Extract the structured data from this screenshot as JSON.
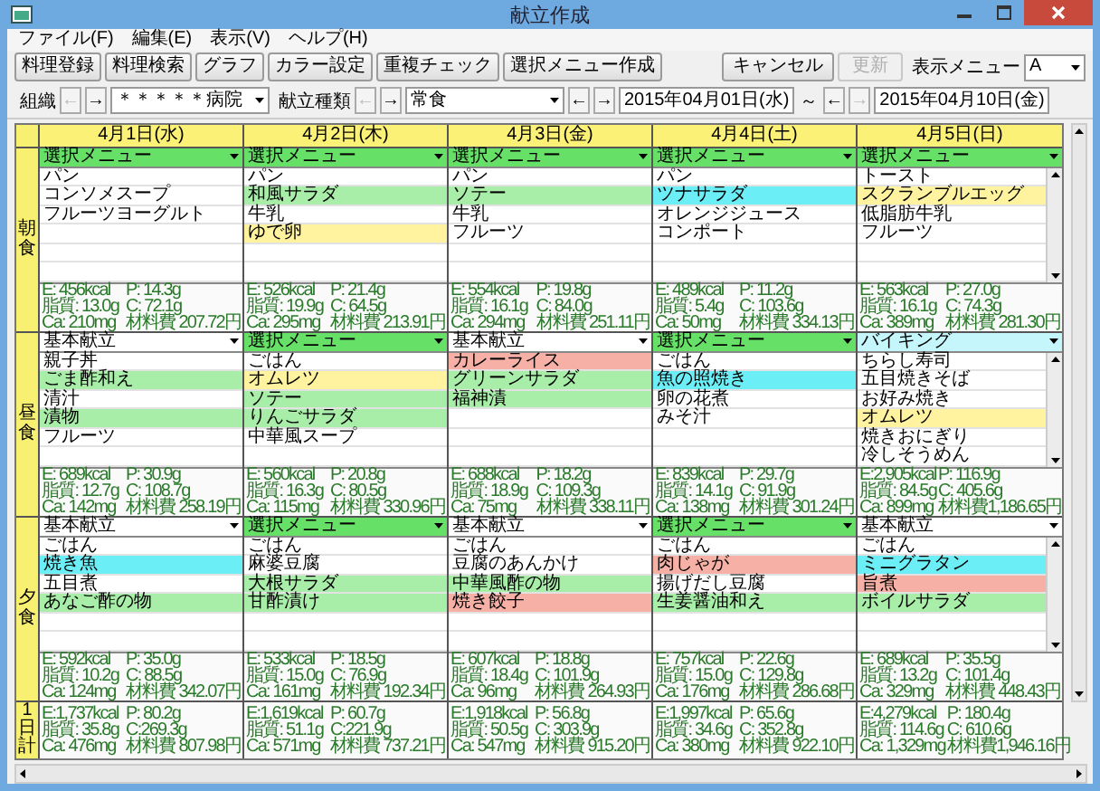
{
  "window": {
    "title": "献立作成"
  },
  "menu": [
    "ファイル(F)",
    "編集(E)",
    "表示(V)",
    "ヘルプ(H)"
  ],
  "toolbar": {
    "buttons": [
      {
        "label": "料理登録",
        "disabled": false
      },
      {
        "label": "料理検索",
        "disabled": false
      },
      {
        "label": "グラフ",
        "disabled": false
      },
      {
        "label": "カラー設定",
        "disabled": false
      },
      {
        "label": "重複チェック",
        "disabled": false
      },
      {
        "label": "選択メニュー作成",
        "disabled": false
      }
    ],
    "right_buttons": [
      {
        "label": "キャンセル",
        "disabled": false
      },
      {
        "label": "更新",
        "disabled": true
      }
    ],
    "display_menu": {
      "label": "表示メニュー",
      "value": "A"
    }
  },
  "filters": [
    {
      "kind": "dropdown",
      "label": "組織",
      "prev": "←",
      "next": "→",
      "prev_disabled": true,
      "next_disabled": false,
      "value": "＊＊＊＊＊病院"
    },
    {
      "kind": "dropdown",
      "label": "献立種類",
      "prev": "←",
      "next": "→",
      "prev_disabled": true,
      "next_disabled": false,
      "value": "常食"
    },
    {
      "kind": "date",
      "prev": "←",
      "next": "→",
      "prev_disabled": false,
      "next_disabled": false,
      "value": "2015年04月01日(水)"
    },
    {
      "kind": "separator",
      "label": "～"
    },
    {
      "kind": "date",
      "prev": "←",
      "next": "→",
      "prev_disabled": false,
      "next_disabled": true,
      "value": "2015年04月10日(金)"
    }
  ],
  "meal_labels": [
    "朝食",
    "昼食",
    "夕食"
  ],
  "total_label": "1日計",
  "days": [
    {
      "date": "4月1日(水)",
      "meals": [
        {
          "menu_type": "選択メニュー",
          "color": "#66e066",
          "scrollbar": false,
          "items": [
            {
              "name": "パン",
              "color": "#ffffff"
            },
            {
              "name": "コンソメスープ",
              "color": "#ffffff"
            },
            {
              "name": "フルーツヨーグルト",
              "color": "#ffffff"
            }
          ],
          "nutrition": [
            "E: 456kcal",
            "P: 14.3g",
            "脂質: 13.0g",
            "C: 72.1g",
            "Ca: 210mg",
            "材料費 207.72円"
          ]
        },
        {
          "menu_type": "基本献立",
          "color": "#ffffff",
          "scrollbar": false,
          "items": [
            {
              "name": "親子丼",
              "color": "#ffffff"
            },
            {
              "name": "ごま酢和え",
              "color": "#a8eea8"
            },
            {
              "name": "清汁",
              "color": "#ffffff"
            },
            {
              "name": "漬物",
              "color": "#a8eea8"
            },
            {
              "name": "フルーツ",
              "color": "#ffffff"
            }
          ],
          "nutrition": [
            "E: 689kcal",
            "P: 30.9g",
            "脂質: 12.7g",
            "C: 108.7g",
            "Ca: 142mg",
            "材料費 258.19円"
          ]
        },
        {
          "menu_type": "基本献立",
          "color": "#ffffff",
          "scrollbar": false,
          "items": [
            {
              "name": "ごはん",
              "color": "#ffffff"
            },
            {
              "name": "焼き魚",
              "color": "#6ceef6"
            },
            {
              "name": "五目煮",
              "color": "#ffffff"
            },
            {
              "name": "あなご酢の物",
              "color": "#a8eea8"
            }
          ],
          "nutrition": [
            "E: 592kcal",
            "P: 35.0g",
            "脂質: 10.2g",
            "C: 88.5g",
            "Ca: 124mg",
            "材料費 342.07円"
          ]
        }
      ],
      "total": [
        "E:1,737kcal",
        "P: 80.2g",
        "脂質: 35.8g",
        "C:269.3g",
        "Ca: 476mg",
        "材料費 807.98円"
      ]
    },
    {
      "date": "4月2日(木)",
      "meals": [
        {
          "menu_type": "選択メニュー",
          "color": "#66e066",
          "scrollbar": false,
          "items": [
            {
              "name": "パン",
              "color": "#ffffff"
            },
            {
              "name": "和風サラダ",
              "color": "#a8eea8"
            },
            {
              "name": "牛乳",
              "color": "#ffffff"
            },
            {
              "name": "ゆで卵",
              "color": "#fff3a0"
            }
          ],
          "nutrition": [
            "E: 526kcal",
            "P: 21.4g",
            "脂質: 19.9g",
            "C: 64.5g",
            "Ca: 295mg",
            "材料費 213.91円"
          ]
        },
        {
          "menu_type": "選択メニュー",
          "color": "#66e066",
          "scrollbar": false,
          "items": [
            {
              "name": "ごはん",
              "color": "#ffffff"
            },
            {
              "name": "オムレツ",
              "color": "#fff3a0"
            },
            {
              "name": "ソテー",
              "color": "#a8eea8"
            },
            {
              "name": "りんごサラダ",
              "color": "#a8eea8"
            },
            {
              "name": "中華風スープ",
              "color": "#ffffff"
            }
          ],
          "nutrition": [
            "E: 560kcal",
            "P: 20.8g",
            "脂質: 16.3g",
            "C: 80.5g",
            "Ca: 115mg",
            "材料費 330.96円"
          ]
        },
        {
          "menu_type": "選択メニュー",
          "color": "#66e066",
          "scrollbar": false,
          "items": [
            {
              "name": "ごはん",
              "color": "#ffffff"
            },
            {
              "name": "麻婆豆腐",
              "color": "#ffffff"
            },
            {
              "name": "大根サラダ",
              "color": "#a8eea8"
            },
            {
              "name": "甘酢漬け",
              "color": "#a8eea8"
            }
          ],
          "nutrition": [
            "E: 533kcal",
            "P: 18.5g",
            "脂質: 15.0g",
            "C: 76.9g",
            "Ca: 161mg",
            "材料費 192.34円"
          ]
        }
      ],
      "total": [
        "E:1,619kcal",
        "P: 60.7g",
        "脂質: 51.1g",
        "C:221.9g",
        "Ca: 571mg",
        "材料費 737.21円"
      ]
    },
    {
      "date": "4月3日(金)",
      "meals": [
        {
          "menu_type": "選択メニュー",
          "color": "#66e066",
          "scrollbar": false,
          "items": [
            {
              "name": "パン",
              "color": "#ffffff"
            },
            {
              "name": "ソテー",
              "color": "#a8eea8"
            },
            {
              "name": "牛乳",
              "color": "#ffffff"
            },
            {
              "name": "フルーツ",
              "color": "#ffffff"
            }
          ],
          "nutrition": [
            "E: 554kcal",
            "P: 19.8g",
            "脂質: 16.1g",
            "C: 84.0g",
            "Ca: 294mg",
            "材料費 251.11円"
          ]
        },
        {
          "menu_type": "基本献立",
          "color": "#ffffff",
          "scrollbar": false,
          "items": [
            {
              "name": "カレーライス",
              "color": "#f6b0a6"
            },
            {
              "name": "グリーンサラダ",
              "color": "#a8eea8"
            },
            {
              "name": "福神漬",
              "color": "#a8eea8"
            }
          ],
          "nutrition": [
            "E: 688kcal",
            "P: 18.2g",
            "脂質: 18.9g",
            "C: 109.3g",
            "Ca: 75mg",
            "材料費 338.11円"
          ]
        },
        {
          "menu_type": "基本献立",
          "color": "#ffffff",
          "scrollbar": false,
          "items": [
            {
              "name": "ごはん",
              "color": "#ffffff"
            },
            {
              "name": "豆腐のあんかけ",
              "color": "#ffffff"
            },
            {
              "name": "中華風酢の物",
              "color": "#a8eea8"
            },
            {
              "name": "焼き餃子",
              "color": "#f6b0a6"
            }
          ],
          "nutrition": [
            "E: 607kcal",
            "P: 18.8g",
            "脂質: 18.4g",
            "C: 101.9g",
            "Ca: 96mg",
            "材料費 264.93円"
          ]
        }
      ],
      "total": [
        "E:1,918kcal",
        "P: 56.8g",
        "脂質: 50.5g",
        "C: 303.9g",
        "Ca: 547mg",
        "材料費 915.20円"
      ]
    },
    {
      "date": "4月4日(土)",
      "meals": [
        {
          "menu_type": "選択メニュー",
          "color": "#66e066",
          "scrollbar": false,
          "items": [
            {
              "name": "パン",
              "color": "#ffffff"
            },
            {
              "name": "ツナサラダ",
              "color": "#6ceef6"
            },
            {
              "name": "オレンジジュース",
              "color": "#ffffff"
            },
            {
              "name": "コンポート",
              "color": "#ffffff"
            }
          ],
          "nutrition": [
            "E: 489kcal",
            "P: 11.2g",
            "脂質: 5.4g",
            "C: 103.6g",
            "Ca: 50mg",
            "材料費 334.13円"
          ]
        },
        {
          "menu_type": "選択メニュー",
          "color": "#66e066",
          "scrollbar": false,
          "items": [
            {
              "name": "ごはん",
              "color": "#ffffff"
            },
            {
              "name": "魚の照焼き",
              "color": "#6ceef6"
            },
            {
              "name": "卵の花煮",
              "color": "#ffffff"
            },
            {
              "name": "みそ汁",
              "color": "#ffffff"
            }
          ],
          "nutrition": [
            "E: 839kcal",
            "P: 29.7g",
            "脂質: 14.1g",
            "C: 91.9g",
            "Ca: 138mg",
            "材料費 301.24円"
          ]
        },
        {
          "menu_type": "選択メニュー",
          "color": "#66e066",
          "scrollbar": false,
          "items": [
            {
              "name": "ごはん",
              "color": "#ffffff"
            },
            {
              "name": "肉じゃが",
              "color": "#f6b0a6"
            },
            {
              "name": "揚げだし豆腐",
              "color": "#ffffff"
            },
            {
              "name": "生姜醤油和え",
              "color": "#a8eea8"
            }
          ],
          "nutrition": [
            "E: 757kcal",
            "P: 22.6g",
            "脂質: 15.0g",
            "C: 129.8g",
            "Ca: 176mg",
            "材料費 286.68円"
          ]
        }
      ],
      "total": [
        "E:1,997kcal",
        "P: 65.6g",
        "脂質: 34.6g",
        "C: 352.8g",
        "Ca: 380mg",
        "材料費 922.10円"
      ]
    },
    {
      "date": "4月5日(日)",
      "meals": [
        {
          "menu_type": "選択メニュー",
          "color": "#66e066",
          "scrollbar": true,
          "items": [
            {
              "name": "トースト",
              "color": "#ffffff"
            },
            {
              "name": "スクランブルエッグ",
              "color": "#fff3a0"
            },
            {
              "name": "低脂肪牛乳",
              "color": "#ffffff"
            },
            {
              "name": "フルーツ",
              "color": "#ffffff"
            }
          ],
          "nutrition": [
            "E: 563kcal",
            "P: 27.0g",
            "脂質: 16.1g",
            "C: 74.3g",
            "Ca: 389mg",
            "材料費 281.30円"
          ]
        },
        {
          "menu_type": "バイキング",
          "color": "#c4f6fc",
          "scrollbar": true,
          "items": [
            {
              "name": "ちらし寿司",
              "color": "#ffffff"
            },
            {
              "name": "五目焼きそば",
              "color": "#ffffff"
            },
            {
              "name": "お好み焼き",
              "color": "#ffffff"
            },
            {
              "name": "オムレツ",
              "color": "#fff3a0"
            },
            {
              "name": "焼きおにぎり",
              "color": "#ffffff"
            },
            {
              "name": "冷しそうめん",
              "color": "#ffffff"
            }
          ],
          "nutrition": [
            "E:2,905kcal",
            "P: 116.9g",
            "脂質: 84.5g",
            "C: 405.6g",
            "Ca: 899mg",
            "材料費1,186.65円"
          ]
        },
        {
          "menu_type": "基本献立",
          "color": "#ffffff",
          "scrollbar": true,
          "items": [
            {
              "name": "ごはん",
              "color": "#ffffff"
            },
            {
              "name": "ミニグラタン",
              "color": "#6ceef6"
            },
            {
              "name": "旨煮",
              "color": "#f6b0a6"
            },
            {
              "name": "ボイルサラダ",
              "color": "#a8eea8"
            }
          ],
          "nutrition": [
            "E: 689kcal",
            "P: 35.5g",
            "脂質: 13.2g",
            "C: 101.4g",
            "Ca: 329mg",
            "材料費 448.43円"
          ]
        }
      ],
      "total": [
        "E:4,279kcal",
        "P: 180.4g",
        "脂質: 114.6g",
        "C: 610.6g",
        "Ca: 1,329mg",
        "材料費1,946.16円"
      ]
    }
  ]
}
